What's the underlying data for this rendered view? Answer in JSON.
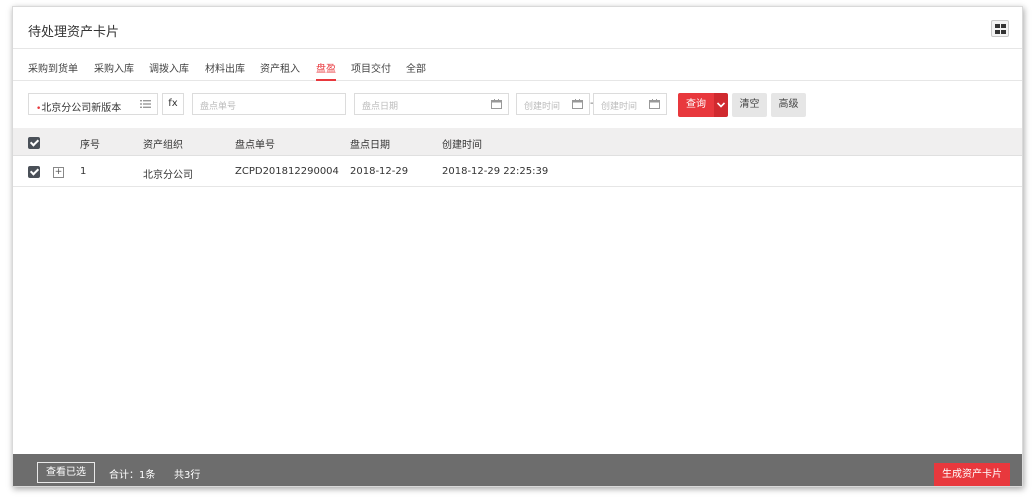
{
  "window": {
    "title": "待处理资产卡片",
    "grid_icon": "grid-view-icon"
  },
  "tabs": [
    {
      "label": "采购到货单",
      "active": false
    },
    {
      "label": "采购入库",
      "active": false
    },
    {
      "label": "调拨入库",
      "active": false
    },
    {
      "label": "材料出库",
      "active": false
    },
    {
      "label": "资产租入",
      "active": false
    },
    {
      "label": "盘盈",
      "active": true
    },
    {
      "label": "项目交付",
      "active": false
    },
    {
      "label": "全部",
      "active": false
    }
  ],
  "filter": {
    "org_required_mark": "•",
    "org_value": "北京分公司新版本",
    "org_icon": "list-icon",
    "fx_label": "fx",
    "doc_no_placeholder": "盘点单号",
    "date_placeholder": "盘点日期",
    "create_from_placeholder": "创建时间",
    "create_to_placeholder": "创建时间",
    "range_separator": "-",
    "calendar_icon": "calendar-icon",
    "query_label": "查询",
    "caret_icon": "chevron-down-icon",
    "clear_label": "清空",
    "advanced_label": "高级"
  },
  "table": {
    "headers": {
      "seq": "序号",
      "org": "资产组织",
      "doc_no": "盘点单号",
      "date": "盘点日期",
      "created": "创建时间"
    },
    "rows": [
      {
        "checked": true,
        "expand_icon": "+",
        "seq": "1",
        "org": "北京分公司",
        "doc_no": "ZCPD201812290004",
        "date": "2018-12-29",
        "created": "2018-12-29 22:25:39"
      }
    ]
  },
  "footer": {
    "view_selected_label": "查看已选",
    "total_label": "合计：1条",
    "rows_label": "共3行",
    "generate_label": "生成资产卡片"
  },
  "colors": {
    "accent": "#e8383d",
    "footer_bg": "#6d6d6d",
    "header_bg": "#f0efef"
  }
}
